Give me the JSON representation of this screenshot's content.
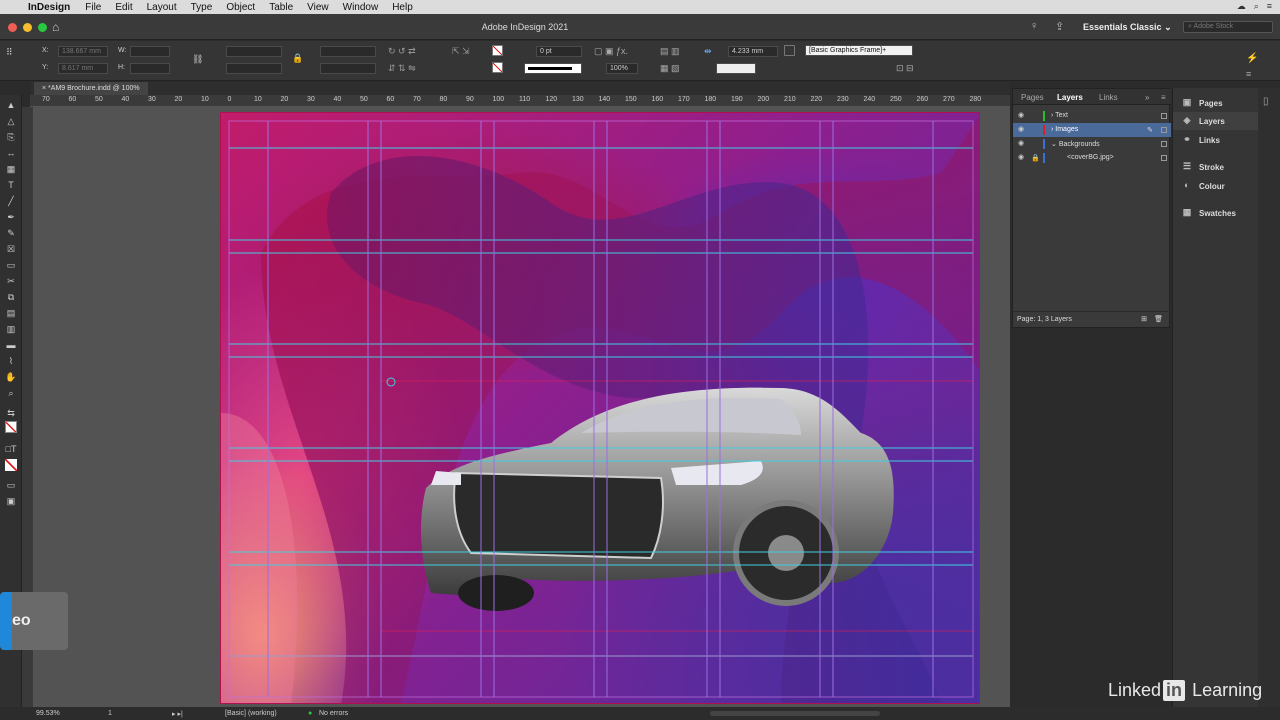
{
  "menubar": {
    "app_name": "InDesign",
    "items": [
      "File",
      "Edit",
      "Layout",
      "Type",
      "Object",
      "Table",
      "View",
      "Window",
      "Help"
    ]
  },
  "appbar": {
    "title": "Adobe InDesign 2021",
    "workspace": "Essentials Classic",
    "stock_placeholder": "Adobe Stock"
  },
  "control": {
    "x_value": "138.667 mm",
    "y_value": "8.617 mm",
    "w_label": "W:",
    "h_label": "H:",
    "x_label": "X:",
    "y_label": "Y:",
    "stroke_weight": "0 pt",
    "scale": "100%",
    "gap_value": "4.233 mm",
    "style": "[Basic Graphics Frame]+"
  },
  "document": {
    "tab": "*AM9 Brochure.indd @ 100%",
    "ruler_labels": [
      "70",
      "60",
      "50",
      "40",
      "30",
      "20",
      "10",
      "0",
      "10",
      "20",
      "30",
      "40",
      "50",
      "60",
      "70",
      "80",
      "90",
      "100",
      "110",
      "120",
      "130",
      "140",
      "150",
      "160",
      "170",
      "180",
      "190",
      "200",
      "210",
      "220",
      "230",
      "240",
      "250",
      "260",
      "270",
      "280"
    ]
  },
  "layers_panel": {
    "tabs": [
      "Pages",
      "Layers",
      "Links"
    ],
    "active_tab": "Layers",
    "layers": [
      {
        "name": "Text",
        "color": "#27c02a",
        "selected": false
      },
      {
        "name": "Images",
        "color": "#e02020",
        "selected": true
      },
      {
        "name": "Backgrounds",
        "color": "#3a6fd8",
        "selected": false
      },
      {
        "name": "<coverBG.jpg>",
        "color": "#3a6fd8",
        "selected": false
      }
    ],
    "footer": "Page: 1, 3 Layers"
  },
  "dock": {
    "items": [
      "Pages",
      "Layers",
      "Links",
      "Stroke",
      "Colour",
      "Swatches"
    ]
  },
  "status": {
    "zoom": "99.53%",
    "page": "1",
    "profile": "[Basic] (working)",
    "errors": "No errors"
  },
  "overlay": {
    "hud_text": "eo",
    "brand_left": "Linked",
    "brand_in": "in",
    "brand_right": "Learning"
  },
  "colors": {
    "guide_cyan": "#3fd0e0",
    "guide_purple": "#9b6fe0",
    "selection_blue": "#4a6a9a"
  }
}
